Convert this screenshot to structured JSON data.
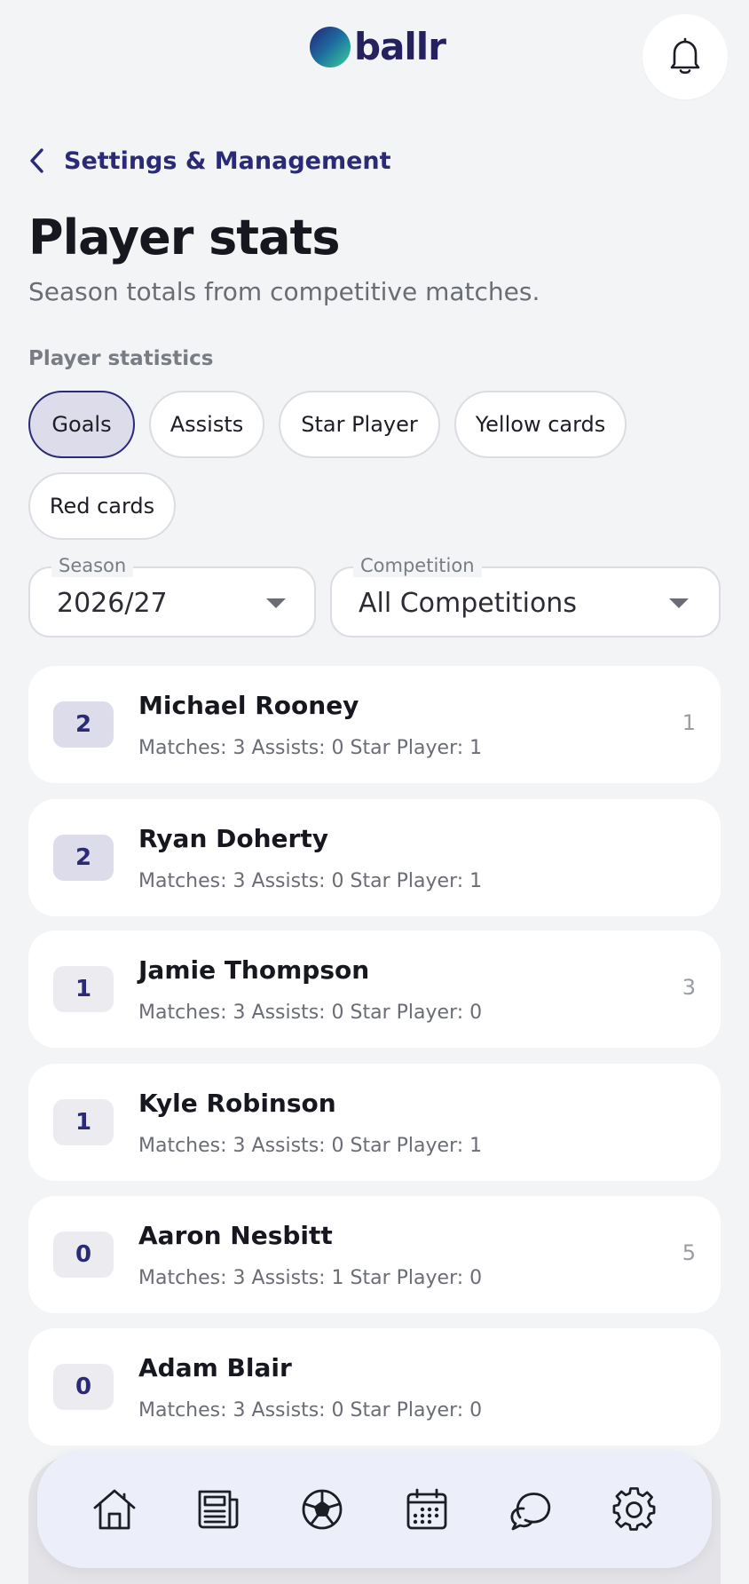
{
  "header": {
    "logo_text": "ballr",
    "bell_icon": "bell-icon"
  },
  "nav": {
    "back_label": "Settings & Management",
    "back_icon": "chevron-left-icon"
  },
  "page": {
    "title": "Player stats",
    "subtitle": "Season totals from competitive matches.",
    "section_label": "Player statistics"
  },
  "chips": [
    {
      "label": "Goals",
      "active": true
    },
    {
      "label": "Assists",
      "active": false
    },
    {
      "label": "Star Player",
      "active": false
    },
    {
      "label": "Yellow cards",
      "active": false
    },
    {
      "label": "Red cards",
      "active": false
    }
  ],
  "filters": {
    "season": {
      "label": "Season",
      "value": "2026/27"
    },
    "competition": {
      "label": "Competition",
      "value": "All Competitions"
    }
  },
  "players": [
    {
      "rank": "2",
      "name": "Michael Rooney",
      "meta": "Matches: 3 Assists: 0 Star Player: 1",
      "side": "1"
    },
    {
      "rank": "2",
      "name": "Ryan Doherty",
      "meta": "Matches: 3 Assists: 0 Star Player: 1",
      "side": ""
    },
    {
      "rank": "1",
      "name": "Jamie Thompson",
      "meta": "Matches: 3 Assists: 0 Star Player: 0",
      "side": "3"
    },
    {
      "rank": "1",
      "name": "Kyle Robinson",
      "meta": "Matches: 3 Assists: 0 Star Player: 1",
      "side": ""
    },
    {
      "rank": "0",
      "name": "Aaron Nesbitt",
      "meta": "Matches: 3 Assists: 1 Star Player: 0",
      "side": "5"
    },
    {
      "rank": "0",
      "name": "Adam Blair",
      "meta": "Matches: 3 Assists: 0 Star Player: 0",
      "side": ""
    }
  ],
  "tabbar": {
    "icons": [
      "home-icon",
      "news-icon",
      "football-icon",
      "calendar-icon",
      "chat-icon",
      "settings-gear-icon"
    ]
  },
  "colors": {
    "brand": "#2b2a77",
    "background": "#f3f4f6",
    "badge_purple": "#dcdcea",
    "badge_gray": "#ececf0",
    "tabbar": "#eceef9"
  }
}
